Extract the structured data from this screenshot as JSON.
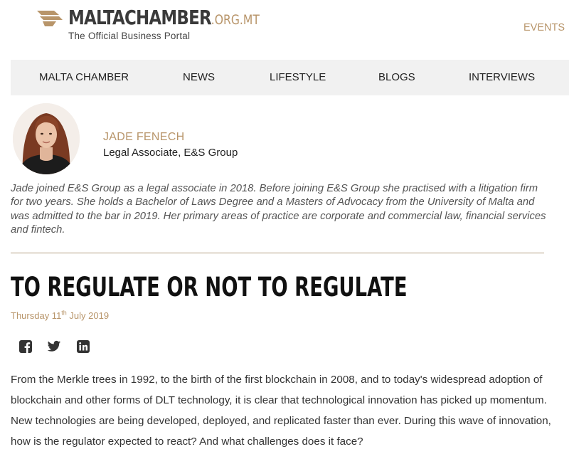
{
  "header": {
    "logo_main": "MALTACHAMBER",
    "logo_domain": ".ORG.MT",
    "logo_tagline": "The Official Business Portal",
    "events_link": "EVENTS",
    "logo_icon": "malta-chamber-logo"
  },
  "nav": {
    "items": [
      {
        "label": "MALTA CHAMBER"
      },
      {
        "label": "NEWS"
      },
      {
        "label": "LIFESTYLE"
      },
      {
        "label": "BLOGS"
      },
      {
        "label": "INTERVIEWS"
      }
    ]
  },
  "author": {
    "name": "JADE FENECH",
    "role": "Legal Associate, E&S Group",
    "bio": "Jade joined E&S Group as a legal associate in 2018. Before joining E&S Group she practised with a litigation firm for two years. She holds a Bachelor of Laws Degree and a Masters of Advocacy from the University of Malta and was admitted to the bar in 2019. Her primary areas of practice are corporate and commercial law, financial services and fintech."
  },
  "article": {
    "title": "TO REGULATE OR NOT TO REGULATE",
    "date_prefix": "Thursday 11",
    "date_sup": "th",
    "date_suffix": " July 2019",
    "body": "From the Merkle trees in 1992, to the birth of the first blockchain in 2008, and to today's widespread adoption of blockchain and other forms of DLT technology, it is clear that technological innovation has picked up momentum. New technologies are being developed, deployed, and replicated faster than ever. During this wave of innovation, how is the regulator expected to react? And what challenges does it face?"
  },
  "social": {
    "icons": [
      "facebook-icon",
      "twitter-icon",
      "linkedin-icon"
    ]
  },
  "colors": {
    "accent": "#b8956a",
    "nav_background": "#f1f1f1",
    "divider": "#b39c80"
  }
}
